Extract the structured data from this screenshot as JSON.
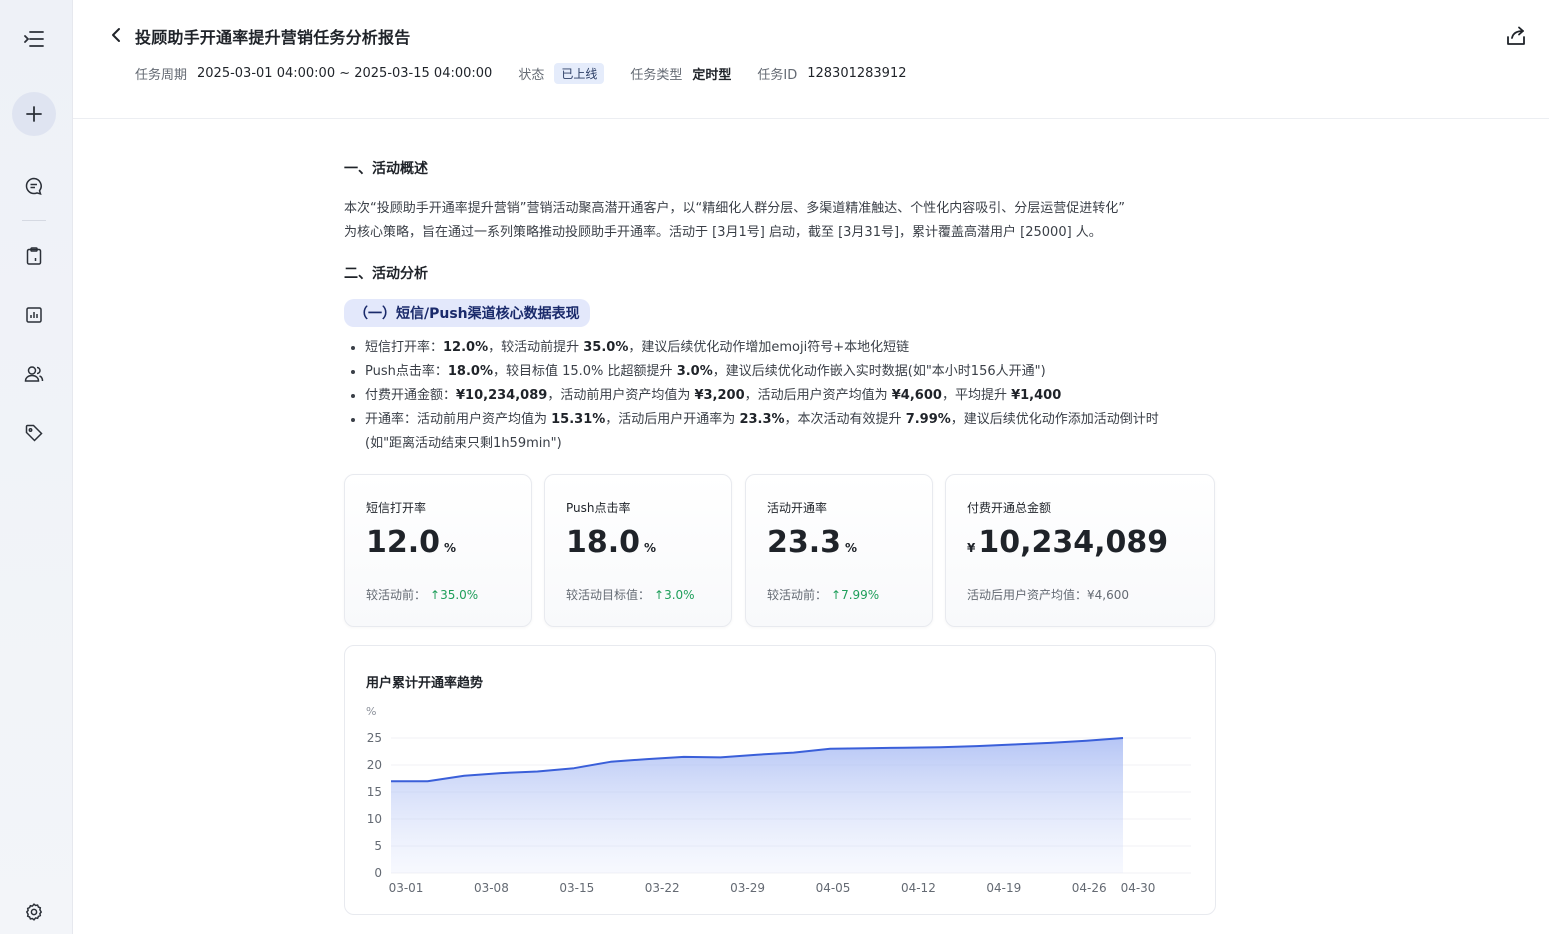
{
  "header": {
    "title": "投顾助手开通率提升营销任务分析报告",
    "period_label": "任务周期",
    "period_value": "2025-03-01 04:00:00 ~ 2025-03-15 04:00:00",
    "status_label": "状态",
    "status_value": "已上线",
    "type_label": "任务类型",
    "type_value": "定时型",
    "id_label": "任务ID",
    "id_value": "128301283912"
  },
  "section1": {
    "heading": "一、活动概述",
    "line1": "本次“投顾助手开通率提升营销”营销活动聚高潜开通客户，以“精细化人群分层、多渠道精准触达、个性化内容吸引、分层运营促进转化”",
    "line2": "为核心策略，旨在通过一系列策略推动投顾助手开通率。活动于 [3月1号] 启动，截至 [3月31号]，累计覆盖高潜用户 [25000] 人。"
  },
  "section2": {
    "heading": "二、活动分析",
    "sub_heading": "（一）短信/Push渠道核心数据表现",
    "bullets": [
      {
        "a": "短信打开率：",
        "b": "12.0%",
        "c": "，较活动前提升 ",
        "d": "35.0%",
        "e": "，建议后续优化动作增加emoji符号+本地化短链"
      },
      {
        "a": "Push点击率：",
        "b": "18.0%",
        "c": "，较目标值 15.0% 比超额提升 ",
        "d": "3.0%",
        "e": "，建议后续优化动作嵌入实时数据(如\"本小时156人开通\")"
      },
      {
        "a": "付费开通金额：",
        "b": "¥10,234,089",
        "c": "，活动前用户资产均值为 ",
        "d": "¥3,200",
        "e": "，活动后用户资产均值为 ",
        "f": "¥4,600",
        "g": "，平均提升 ",
        "h": "¥1,400"
      },
      {
        "a": "开通率：活动前用户资产均值为 ",
        "b": "15.31%",
        "c": "，活动后用户开通率为 ",
        "d": "23.3%",
        "e": "，本次活动有效提升 ",
        "f": "7.99%",
        "g": "，建议后续优化动作添加活动倒计时",
        "line2": "(如\"距离活动结束只剩1h59min\")"
      }
    ]
  },
  "cards": [
    {
      "label": "短信打开率",
      "value": "12.0",
      "unit": "%",
      "foot_label": "较活动前：",
      "foot_value": "35.0%"
    },
    {
      "label": "Push点击率",
      "value": "18.0",
      "unit": "%",
      "foot_label": "较活动目标值：",
      "foot_value": "3.0%"
    },
    {
      "label": "活动开通率",
      "value": "23.3",
      "unit": "%",
      "foot_label": "较活动前：",
      "foot_value": "7.99%"
    },
    {
      "label": "付费开通总金额",
      "currency": "¥",
      "value": "10,234,089",
      "foot_text": "活动后用户资产均值：¥4,600"
    }
  ],
  "colors": {
    "accent": "#3a5fd9",
    "up": "#1e9e5a"
  },
  "chart_data": {
    "type": "area",
    "title": "用户累计开通率趋势",
    "ylabel": "%",
    "ylim": [
      0,
      25
    ],
    "yticks": [
      0,
      5,
      10,
      15,
      20,
      25
    ],
    "xticks": [
      "03-01",
      "03-08",
      "03-15",
      "03-22",
      "03-29",
      "04-05",
      "04-12",
      "04-19",
      "04-26",
      "04-30"
    ],
    "series": [
      {
        "x": [
          "03-01",
          "03-04",
          "03-07",
          "03-10",
          "03-13",
          "03-16",
          "03-19",
          "03-22",
          "03-25",
          "03-28",
          "03-31",
          "04-03",
          "04-06",
          "04-09",
          "04-12",
          "04-15",
          "04-18",
          "04-21",
          "04-24",
          "04-27",
          "04-30"
        ],
        "values": [
          17.0,
          17.0,
          18.0,
          18.5,
          18.8,
          19.4,
          20.6,
          21.1,
          21.5,
          21.4,
          21.9,
          22.3,
          23.0,
          23.1,
          23.2,
          23.3,
          23.5,
          23.8,
          24.1,
          24.5,
          25.0
        ]
      }
    ],
    "grid": true,
    "legend": "none"
  }
}
